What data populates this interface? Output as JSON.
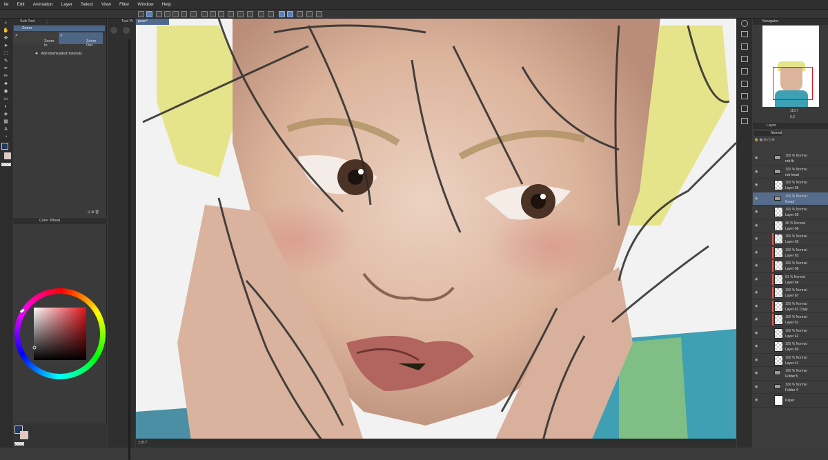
{
  "menu": [
    "ile",
    "Edit",
    "Animation",
    "Layer",
    "Select",
    "View",
    "Filter",
    "Window",
    "Help"
  ],
  "subtool": {
    "tab_label": "Sub Tool",
    "selected_tool": "Zoom",
    "zoom_in_label": "Zoom In",
    "zoom_out_label": "Zoom Out",
    "add_materials": "Add downloaded materials"
  },
  "color_panel": {
    "tab_label": "Color Wheel"
  },
  "narrow_panel": {
    "tab_label": "Tool Pr"
  },
  "canvas": {
    "tab_label": "peac*",
    "zoom": "115.7"
  },
  "navigator": {
    "tab_label": "Navigator",
    "zoom": "115.7",
    "rotation": "0.0"
  },
  "layers": {
    "tab_label": "Layer",
    "blend_mode": "Normal",
    "items": [
      {
        "top": "100 % Normal",
        "name": "rob fb",
        "type": "folder"
      },
      {
        "top": "100 % Normal",
        "name": "rob head",
        "type": "folder"
      },
      {
        "top": "100 % Normal",
        "name": "Layer 56",
        "type": "layer"
      },
      {
        "top": "100 % Normal",
        "name": "linearl",
        "type": "folder",
        "selected": true
      },
      {
        "top": "100 % Normal",
        "name": "Layer 59",
        "type": "layer"
      },
      {
        "top": "46 % Normal",
        "name": "Layer 66",
        "type": "layer"
      },
      {
        "top": "100 % Normal",
        "name": "Layer 62",
        "type": "layer",
        "clip": true
      },
      {
        "top": "100 % Normal",
        "name": "Layer 63",
        "type": "layer",
        "clip": true
      },
      {
        "top": "100 % Normal",
        "name": "Layer 68",
        "type": "layer",
        "clip": true
      },
      {
        "top": "81 % Normal",
        "name": "Layer 64",
        "type": "layer",
        "clip": true
      },
      {
        "top": "100 % Normal",
        "name": "Layer 67",
        "type": "layer",
        "clip": true
      },
      {
        "top": "100 % Normal",
        "name": "Layer 61 Copy",
        "type": "layer",
        "clip": true
      },
      {
        "top": "100 % Normal",
        "name": "Layer 61",
        "type": "layer",
        "clip": true
      },
      {
        "top": "100 % Normal",
        "name": "Layer 42",
        "type": "layer"
      },
      {
        "top": "100 % Normal",
        "name": "Layer 60",
        "type": "layer"
      },
      {
        "top": "100 % Normal",
        "name": "Layer 41",
        "type": "layer"
      },
      {
        "top": "100 % Normal",
        "name": "Folder 5",
        "type": "folder"
      },
      {
        "top": "100 % Normal",
        "name": "Folder 4",
        "type": "folder"
      },
      {
        "top": "",
        "name": "Paper",
        "type": "paper"
      }
    ]
  },
  "colors": {
    "ui_bg": "#3b3b3b",
    "accent": "#4e6685",
    "hair": "#e6e48a",
    "skin": "#e3c2ab",
    "shirt_teal": "#3f9fb3",
    "shirt_green": "#7fbf86"
  }
}
